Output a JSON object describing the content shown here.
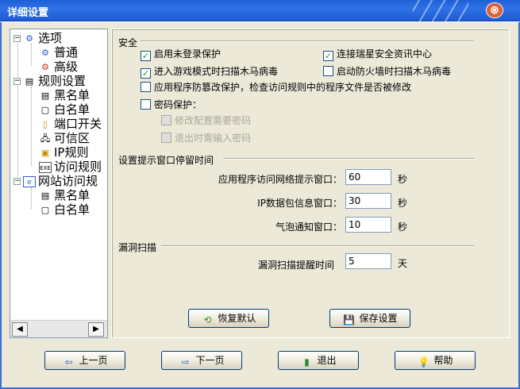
{
  "window": {
    "title": "详细设置",
    "close_glyph": "⊗"
  },
  "tree": {
    "items": [
      {
        "label": "选项",
        "icon": "gear-icon"
      },
      {
        "label": "普通",
        "icon": "gear-small-icon"
      },
      {
        "label": "高级",
        "icon": "gear-small-icon"
      },
      {
        "label": "规则设置",
        "icon": "rules-icon"
      },
      {
        "label": "黑名单",
        "icon": "document-icon"
      },
      {
        "label": "白名单",
        "icon": "document-icon"
      },
      {
        "label": "端口开关",
        "icon": "port-icon"
      },
      {
        "label": "可信区",
        "icon": "network-icon"
      },
      {
        "label": "IP规则",
        "icon": "ip-icon"
      },
      {
        "label": "访问规则",
        "icon": "exe-icon"
      },
      {
        "label": "网站访问规",
        "icon": "web-icon"
      },
      {
        "label": "黑名单",
        "icon": "document-icon"
      },
      {
        "label": "白名单",
        "icon": "document-icon"
      }
    ],
    "scroll_left": "◀",
    "scroll_right": "▶"
  },
  "security": {
    "group_label": "安全",
    "options": [
      {
        "label": "启用未登录保护",
        "checked": true,
        "disabled": false
      },
      {
        "label": "连接瑞星安全资讯中心",
        "checked": true,
        "disabled": false
      },
      {
        "label": "进入游戏模式时扫描木马病毒",
        "checked": true,
        "disabled": false
      },
      {
        "label": "启动防火墙时扫描木马病毒",
        "checked": false,
        "disabled": false
      },
      {
        "label": "应用程序防篡改保护，检查访问规则中的程序文件是否被修改",
        "checked": false,
        "disabled": false
      },
      {
        "label": "密码保护：",
        "checked": false,
        "disabled": false
      },
      {
        "label": "修改配置需要密码",
        "checked": false,
        "disabled": true
      },
      {
        "label": "退出时需输入密码",
        "checked": false,
        "disabled": true
      }
    ]
  },
  "popup_timing": {
    "group_label": "设置提示窗口停留时间",
    "fields": [
      {
        "label": "应用程序访问网络提示窗口：",
        "value": "60",
        "unit": "秒"
      },
      {
        "label": "IP数据包信息窗口：",
        "value": "30",
        "unit": "秒"
      },
      {
        "label": "气泡通知窗口：",
        "value": "10",
        "unit": "秒"
      }
    ]
  },
  "vuln_scan": {
    "group_label": "漏洞扫描",
    "label": "漏洞扫描提醒时间",
    "value": "5",
    "unit": "天"
  },
  "actions": {
    "restore_default": "恢复默认",
    "save_settings": "保存设置"
  },
  "nav": {
    "prev": "上一页",
    "next": "下一页",
    "exit": "退出",
    "help": "帮助"
  }
}
